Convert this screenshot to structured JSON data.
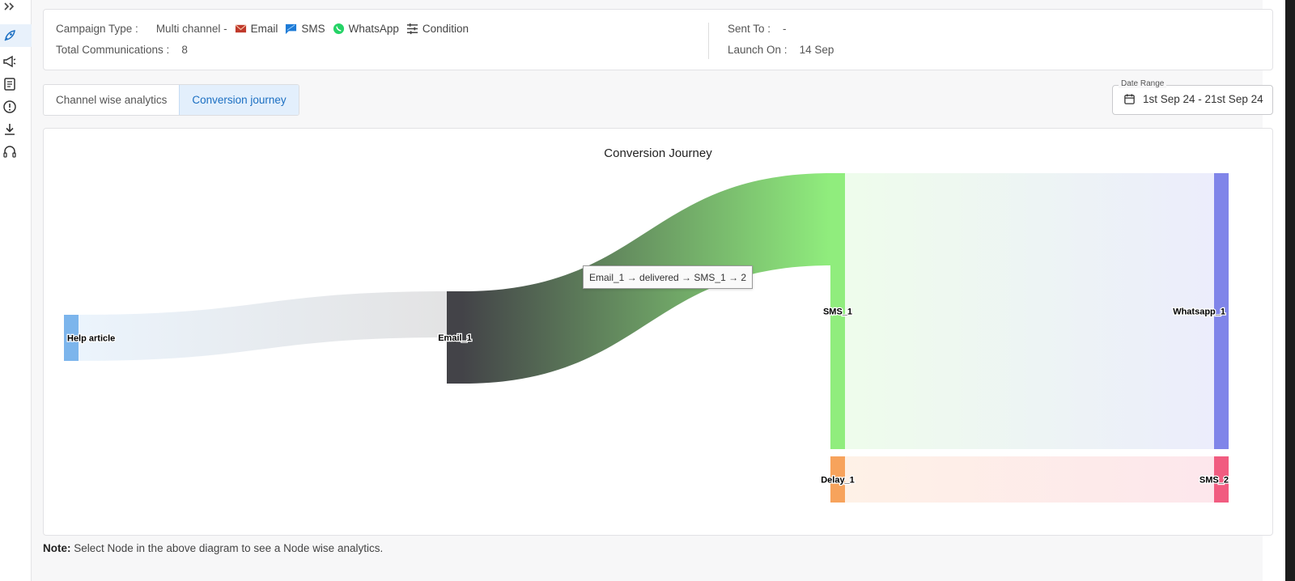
{
  "campaign": {
    "type_label": "Campaign Type :",
    "type_value": "Multi channel -",
    "channels": [
      {
        "name": "Email",
        "icon": "email-icon",
        "color": "#c0392b"
      },
      {
        "name": "SMS",
        "icon": "sms-icon",
        "color": "#1e7bd6"
      },
      {
        "name": "WhatsApp",
        "icon": "whatsapp-icon",
        "color": "#25d366"
      },
      {
        "name": "Condition",
        "icon": "condition-icon",
        "color": "#555555"
      }
    ],
    "total_label": "Total Communications :",
    "total_value": "8",
    "sent_to_label": "Sent To :",
    "sent_to_value": "-",
    "launch_label": "Launch On :",
    "launch_value": "14 Sep"
  },
  "tabs": [
    {
      "label": "Channel wise analytics",
      "active": false
    },
    {
      "label": "Conversion journey",
      "active": true
    }
  ],
  "date_range": {
    "legend": "Date Range",
    "value": "1st Sep 24 - 21st Sep 24",
    "icon": "calendar-icon"
  },
  "chart": {
    "title": "Conversion Journey",
    "tooltip": "Email_1 → delivered → SMS_1 → 2"
  },
  "chart_data": {
    "type": "sankey",
    "title": "Conversion Journey",
    "nodes": [
      {
        "name": "Help article",
        "color": "#7cb5ec"
      },
      {
        "name": "Email_1",
        "color": "#434348"
      },
      {
        "name": "SMS_1",
        "color": "#90ed7d"
      },
      {
        "name": "Delay_1",
        "color": "#f7a35c"
      },
      {
        "name": "Whatsapp_1",
        "color": "#8085e9"
      },
      {
        "name": "SMS_2",
        "color": "#f15c80"
      }
    ],
    "links": [
      {
        "from": "Help article",
        "to": "Email_1",
        "value": 1
      },
      {
        "from": "Email_1",
        "to": "SMS_1",
        "value": 2
      },
      {
        "from": "SMS_1",
        "to": "Whatsapp_1",
        "value": 6
      },
      {
        "from": "Delay_1",
        "to": "SMS_2",
        "value": 1
      }
    ]
  },
  "note": {
    "bold": "Note:",
    "text": " Select Node in the above diagram to see a Node wise analytics."
  },
  "sidebar": {
    "items": [
      {
        "icon": "expand-icon",
        "active": false
      },
      {
        "icon": "rocket-icon",
        "active": true
      },
      {
        "icon": "megaphone-icon",
        "active": false
      },
      {
        "icon": "document-icon",
        "active": false
      },
      {
        "icon": "alert-icon",
        "active": false
      },
      {
        "icon": "download-icon",
        "active": false
      },
      {
        "icon": "headset-icon",
        "active": false
      }
    ]
  }
}
